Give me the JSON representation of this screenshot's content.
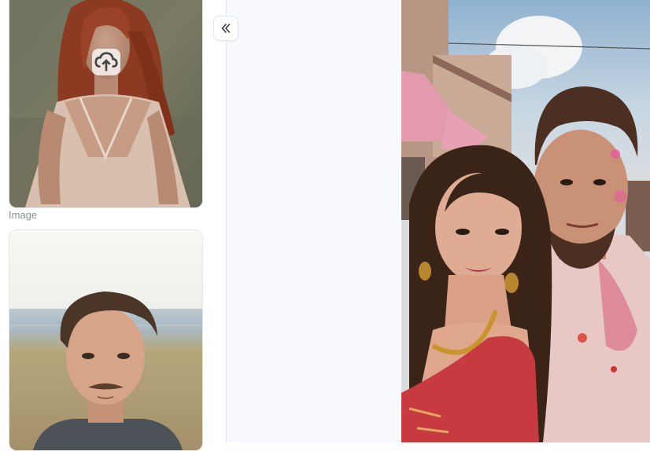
{
  "sidebar": {
    "image_caption": "Image",
    "thumbnails": [
      {
        "icon": "upload-icon"
      },
      {
        "icon": "none"
      }
    ],
    "collapse_icon": "double-chevron-left-icon"
  },
  "result": {
    "icon": "none"
  }
}
